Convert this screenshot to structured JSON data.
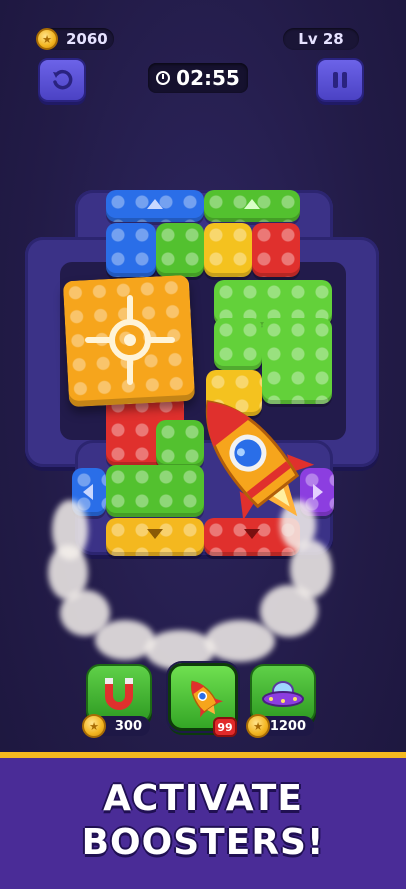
{
  "hud": {
    "coins": "2060",
    "level": "Lv 28",
    "timer": "02:55",
    "undo_icon": "undo-icon",
    "pause_icon": "pause-icon"
  },
  "board": {
    "pieces": [
      {
        "name": "blue",
        "color": "#2a6ee8"
      },
      {
        "name": "green",
        "color": "#53c12f"
      },
      {
        "name": "orange",
        "color": "#f5a21b"
      },
      {
        "name": "red",
        "color": "#e0302d"
      },
      {
        "name": "yellow",
        "color": "#f4c21f"
      }
    ],
    "targeted_piece": "orange"
  },
  "boosters": [
    {
      "name": "magnet-booster",
      "icon": "magnet-icon",
      "price": "300"
    },
    {
      "name": "rocket-booster",
      "icon": "rocket-icon",
      "count": "99"
    },
    {
      "name": "ufo-booster",
      "icon": "ufo-icon",
      "price": "1200"
    }
  ],
  "banner": {
    "line1": "ACTIVATE",
    "line2": "BOOSTERS!"
  },
  "colors": {
    "accent": "#f4b81f",
    "banner_bg": "#4a2c97",
    "button": "#5b52d6"
  }
}
